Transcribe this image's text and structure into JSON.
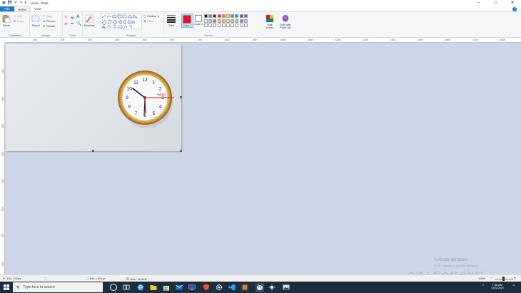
{
  "window": {
    "title": "circle - Paint",
    "controls": [
      "–",
      "□",
      "✕"
    ]
  },
  "menu": {
    "file": "File",
    "tabs": [
      "Home",
      "View"
    ],
    "help": "?"
  },
  "ribbon": {
    "clipboard": {
      "label": "Clipboard",
      "paste": "Paste",
      "cut": "Cut",
      "copy": "Copy"
    },
    "image": {
      "label": "Image",
      "select": "Select",
      "crop": "Crop",
      "resize": "Resize",
      "rotate": "Rotate"
    },
    "tools": {
      "label": "Tools"
    },
    "brushes": "Brushes",
    "shapes": {
      "label": "Shapes",
      "outline": "Outline",
      "fill": "Fill"
    },
    "size": "Size",
    "colors": {
      "label": "Colors",
      "color1": "Color 1",
      "color2": "Color 2",
      "edit": "Edit colors",
      "paint3d": "Edit with Paint 3D",
      "color1_value": "#e81123",
      "color2_value": "#ffffff",
      "palette_row1": [
        "#000000",
        "#7f7f7f",
        "#880015",
        "#ed1c24",
        "#ff7f27",
        "#fff200",
        "#22b14c",
        "#00a2e8",
        "#3f48cc",
        "#a349a4"
      ],
      "palette_row2": [
        "#ffffff",
        "#c3c3c3",
        "#b97a57",
        "#ffaec9",
        "#ffc90e",
        "#efe4b0",
        "#b5e61d",
        "#99d9ea",
        "#7092be",
        "#c8bfe7"
      ],
      "palette_row3": [
        "#ffffff",
        "#ffffff",
        "#ffffff",
        "#ffffff",
        "#ffffff",
        "#ffffff",
        "#ffffff",
        "#ffffff",
        "#ffffff",
        "#ffffff"
      ]
    }
  },
  "ruler": {
    "top": [
      "100",
      "200",
      "300",
      "400",
      "500",
      "600",
      "700",
      "800",
      "900",
      "1000",
      "1100",
      "1200",
      "1300",
      "1400",
      "1500",
      "1600",
      "1700",
      "1800"
    ],
    "left": [
      "100",
      "200",
      "300",
      "400",
      "500",
      "600",
      "700",
      "800"
    ]
  },
  "canvas": {
    "clock_label": "radius",
    "numbers": [
      "12",
      "1",
      "2",
      "3",
      "4",
      "5",
      "6",
      "7",
      "8",
      "9",
      "10",
      "11"
    ]
  },
  "watermark": {
    "line1": "Activate Windows",
    "line2": "Go to Settings to activate Windows.",
    "cn": "@稀土掘金技术社区"
  },
  "status": {
    "position": "104, 192px",
    "selection": "",
    "dimensions": "640 × 391px",
    "size": "Size: 16.9KB",
    "zoom": "100%"
  },
  "taskbar": {
    "search_placeholder": "Type here to search",
    "time": "7:46 AM",
    "date": "10/22/2020"
  }
}
